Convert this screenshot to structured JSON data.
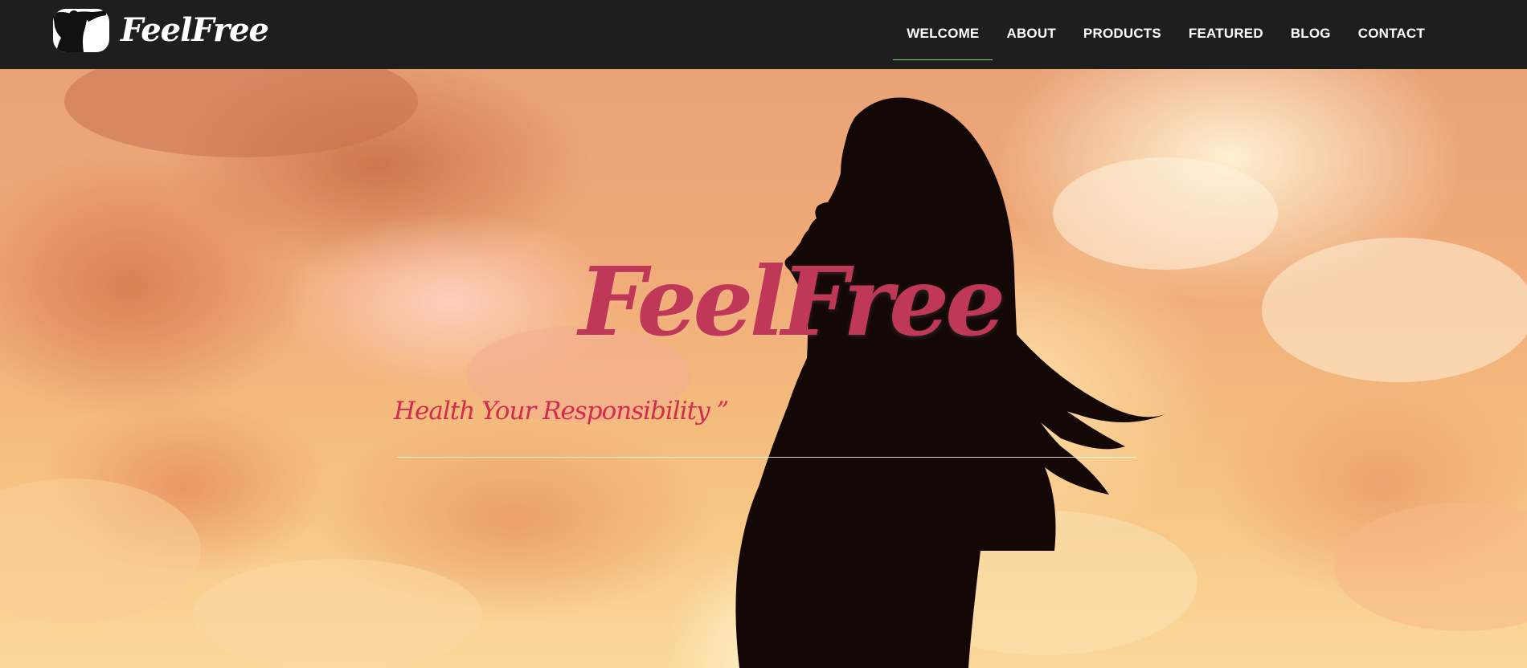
{
  "brand": {
    "name": "FeelFree",
    "logo_icon": "stretching-figure-icon"
  },
  "nav": {
    "items": [
      {
        "label": "WELCOME",
        "active": true
      },
      {
        "label": "ABOUT",
        "active": false
      },
      {
        "label": "PRODUCTS",
        "active": false
      },
      {
        "label": "FEATURED",
        "active": false
      },
      {
        "label": "BLOG",
        "active": false
      },
      {
        "label": "CONTACT",
        "active": false
      }
    ],
    "active_indicator_color": "#7ed36b"
  },
  "hero": {
    "title": "FeelFree",
    "tagline": "Health Your Responsibility ”",
    "title_color": "#c03858",
    "tagline_color": "#d42c4e",
    "background_image": "woman-silhouette-sunset-clouds"
  },
  "colors": {
    "navbar_bg": "#1e1e1e",
    "nav_text": "#ffffff"
  }
}
